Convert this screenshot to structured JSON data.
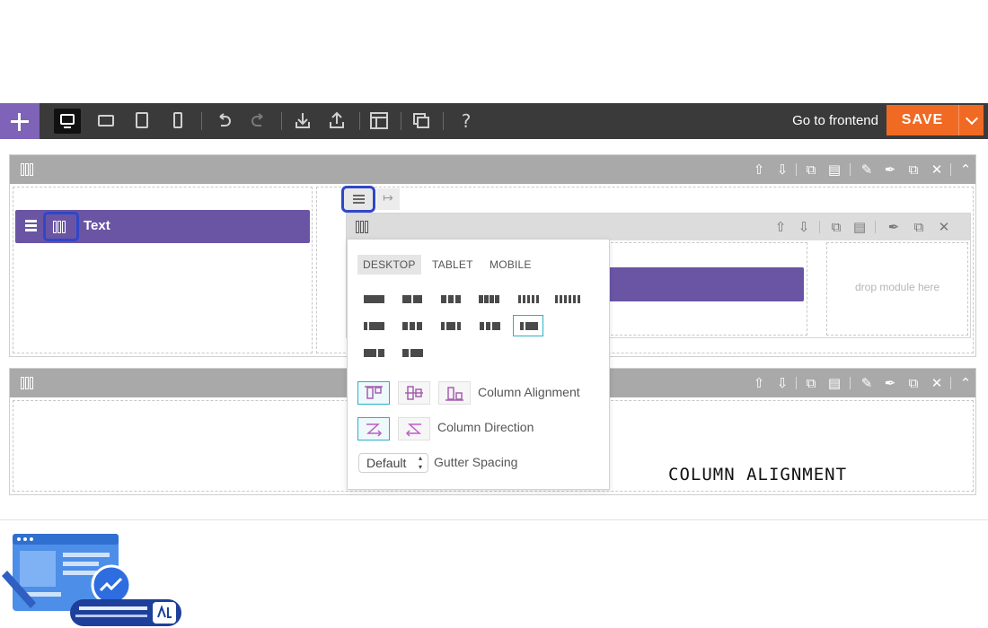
{
  "toolbar": {
    "add_icon": "plus-icon",
    "device_icons": [
      "desktop-icon",
      "tablet-landscape-icon",
      "tablet-portrait-icon",
      "mobile-icon"
    ],
    "action_icons": [
      "undo-icon",
      "redo-icon",
      "import-icon",
      "export-icon",
      "layout-icon",
      "duplicate-icon",
      "help-icon"
    ],
    "frontend_link": "Go to frontend",
    "save_label": "SAVE"
  },
  "builder": {
    "text_module_label": "Text",
    "drop_placeholder": "drop module here"
  },
  "options_panel": {
    "tabs": [
      "DESKTOP",
      "TABLET",
      "MOBILE"
    ],
    "selected_tab": "DESKTOP",
    "column_alignment_label": "Column Alignment",
    "column_direction_label": "Column Direction",
    "gutter_select_value": "Default",
    "gutter_label": "Gutter Spacing"
  },
  "annotation": {
    "caption": "COLUMN ALIGNMENT"
  },
  "colors": {
    "toolbar_bg": "#3a3a3a",
    "accent_purple": "#6a55a4",
    "save_orange": "#f06a24",
    "selection_teal": "#29b0c8",
    "highlight_blue": "#2f47c8"
  }
}
